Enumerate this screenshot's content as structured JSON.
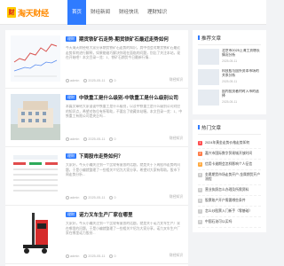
{
  "header": {
    "logo_mark": "财",
    "logo_text": "淘天财经",
    "nav": [
      "首页",
      "财经新闻",
      "财经快讯",
      "理财知识"
    ]
  },
  "posts": [
    {
      "tag": "理财",
      "title": "期货铁矿石走势-期货铁矿石最近走势如何",
      "excerpt": "今天淘天财经给大家分享期货铁矿石走势的知识，其中也会对期货铁矿石最近走势如何进行解释，如果能碰巧解决你现在面临的问题，别忘了关注本站，现在开始吧！本文目录一览：1、铁矿石期货今日最新行情...",
      "author": "admin",
      "date": "2025-05-11",
      "views": "0",
      "category": "财经知识"
    },
    {
      "tag": "理财",
      "title": "中铁重工是什么级别-中铁重工是什么级别公司",
      "excerpt": "本篇文章给大家谈谈中铁重工是什么级别，以及中铁重工是什么级别公司对应的知识点，希望对各位有所帮助，不要忘了收藏本站喔。本文目录一览：1、中铁重工有限公司是央企吗...",
      "author": "admin",
      "date": "2025-05-11",
      "views": "0",
      "category": "财经知识"
    },
    {
      "tag": "理财",
      "title": "下周股市走势如何？",
      "excerpt": "大家好，今天小编关注到一个比较有意思的话题，就是关于下周股市走势的问题，于是小编就整理了一些相关介绍为大家分享，希望对大家有帮助。股市下周走势分析...",
      "author": "admin",
      "date": "2025-05-11",
      "views": "0",
      "category": "财经知识"
    },
    {
      "tag": "理财",
      "title": "诺力叉车生产厂家在哪里",
      "excerpt": "大家好，今天小编关注到一个比较有意思的话题，就是关于诺力叉车生产厂家在哪里的问题，于是小编就整理了一些相关介绍为大家分享，诺力叉车生产厂家在哪里诺力股份...",
      "author": "admin",
      "date": "2025-05-11",
      "views": "0",
      "category": "财经知识"
    }
  ],
  "sidebar": {
    "rec_title": "推荐文章",
    "rec": [
      {
        "title": "北京市2025上海工资增长情况分析",
        "date": "2025-05-11"
      },
      {
        "title": "科技股与国外资本市场的关系分析",
        "date": "2025-05-11"
      },
      {
        "title": "国内投资者何时入市的选择",
        "date": "2025-05-11"
      }
    ],
    "hot_title": "热门文章",
    "hot": [
      "2024年黄金走势价格走势如何",
      "嘉兴市国际数字贸易城开放时间",
      "信用卡逾期会怎样影响个人征信",
      "金属期货市场走势开户-金属期货开户流程",
      "营业执照怎么办理及所需资料",
      "股票账户开户需要哪些条件",
      "怎么炒股票入门新手（零基础）",
      "中国石油可以买吗"
    ]
  }
}
